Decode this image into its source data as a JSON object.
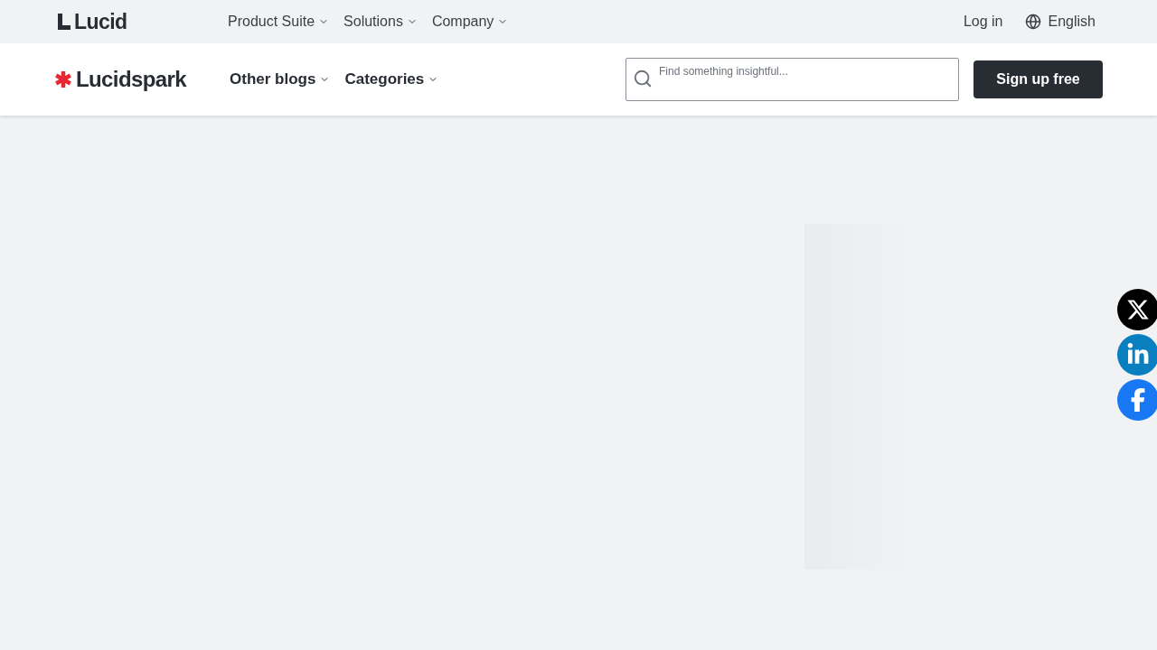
{
  "top_bar": {
    "logo": "Lucid",
    "menu": [
      {
        "label": "Product Suite"
      },
      {
        "label": "Solutions"
      },
      {
        "label": "Company"
      }
    ],
    "login": "Log in",
    "language": "English"
  },
  "blog_bar": {
    "logo": "Lucidspark",
    "menu": [
      {
        "label": "Other blogs"
      },
      {
        "label": "Categories"
      }
    ],
    "search": {
      "placeholder": "Find something insightful..."
    },
    "signup": "Sign up free"
  },
  "share": [
    {
      "kind": "x",
      "color": "#000000"
    },
    {
      "kind": "linkedin",
      "color": "#0a7fbf"
    },
    {
      "kind": "facebook",
      "color": "#1877f2"
    }
  ]
}
